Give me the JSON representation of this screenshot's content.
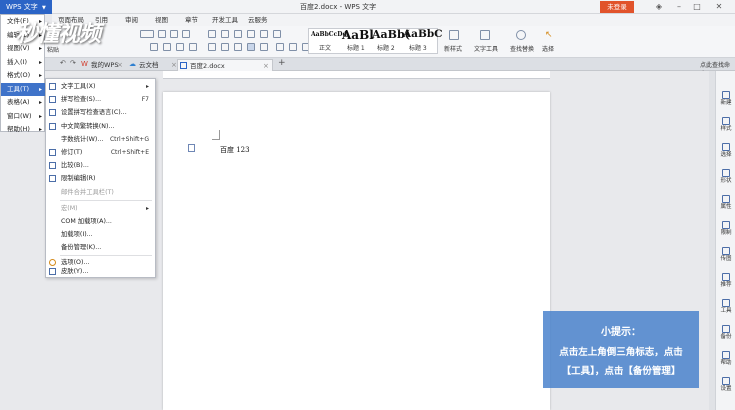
{
  "app": {
    "menu_button": "WPS 文字",
    "window_title": "百度2.docx - WPS 文字",
    "login_label": "未登录"
  },
  "watermark": {
    "text": "秒懂视频"
  },
  "ribbon_tabs": [
    "页面布局",
    "引用",
    "审阅",
    "视图",
    "章节",
    "开发工具",
    "云服务"
  ],
  "ribbon": {
    "styles": [
      {
        "sample": "AaBbCcDd",
        "label": "正文"
      },
      {
        "sample": "AaBl",
        "label": "标题 1"
      },
      {
        "sample": "AaBb(",
        "label": "标题 2"
      },
      {
        "sample": "AaBbC",
        "label": "标题 3"
      }
    ],
    "new_style": "新样式",
    "text_tools": "文字工具",
    "find_replace": "查找替换",
    "select": "选择",
    "paste_hint": "粘贴"
  },
  "doc_tabs": [
    {
      "label": "我的WPS",
      "icon": "wps-icon",
      "active": false
    },
    {
      "label": "云文档",
      "icon": "cloud-icon",
      "active": false
    },
    {
      "label": "百度2.docx",
      "icon": "doc-icon",
      "active": true
    }
  ],
  "find_command": "点此查找命令",
  "main_menu": [
    {
      "label": "文件(F)",
      "active": false
    },
    {
      "label": "编辑(E)",
      "active": false
    },
    {
      "label": "视图(V)",
      "active": false
    },
    {
      "label": "插入(I)",
      "active": false
    },
    {
      "label": "格式(O)",
      "active": false
    },
    {
      "label": "工具(T)",
      "active": true
    },
    {
      "label": "表格(A)",
      "active": false
    },
    {
      "label": "窗口(W)",
      "active": false
    },
    {
      "label": "帮助(H)",
      "active": false
    }
  ],
  "tools_submenu": [
    {
      "label": "文字工具(X)",
      "shortcut": "",
      "arrow": true,
      "icon": "text-tools-icon",
      "disabled": false
    },
    {
      "label": "拼写检查(S)...",
      "shortcut": "F7",
      "arrow": false,
      "icon": "spellcheck-icon",
      "disabled": false
    },
    {
      "label": "设置拼写检查语言(C)...",
      "shortcut": "",
      "arrow": false,
      "icon": "language-icon",
      "disabled": false
    },
    {
      "label": "中文简繁转换(N)...",
      "shortcut": "",
      "arrow": false,
      "icon": "convert-icon",
      "disabled": false
    },
    {
      "label": "字数统计(W)...",
      "shortcut": "Ctrl+Shift+G",
      "arrow": false,
      "icon": "",
      "disabled": false
    },
    {
      "label": "修订(T)",
      "shortcut": "Ctrl+Shift+E",
      "arrow": false,
      "icon": "revision-icon",
      "disabled": false
    },
    {
      "label": "比较(B)...",
      "shortcut": "",
      "arrow": false,
      "icon": "compare-icon",
      "disabled": false
    },
    {
      "label": "限制编辑(R)",
      "shortcut": "",
      "arrow": false,
      "icon": "restrict-icon",
      "disabled": false
    },
    {
      "label": "邮件合并工具栏(T)",
      "shortcut": "",
      "arrow": false,
      "icon": "",
      "disabled": true
    },
    {
      "label": "宏(M)",
      "shortcut": "",
      "arrow": true,
      "icon": "",
      "disabled": true
    },
    {
      "label": "COM 加载项(A)...",
      "shortcut": "",
      "arrow": false,
      "icon": "",
      "disabled": false
    },
    {
      "label": "加载项(I)...",
      "shortcut": "",
      "arrow": false,
      "icon": "",
      "disabled": false
    },
    {
      "label": "备份管理(K)...",
      "shortcut": "",
      "arrow": false,
      "icon": "",
      "disabled": false
    },
    {
      "label": "选项(O)...",
      "shortcut": "",
      "arrow": false,
      "icon": "options-icon",
      "disabled": false
    },
    {
      "label": "皮肤(Y)...",
      "shortcut": "",
      "arrow": false,
      "icon": "skin-icon",
      "disabled": false
    }
  ],
  "document": {
    "text": "百度 123"
  },
  "sidebar": [
    "新建",
    "样式",
    "选择",
    "形状",
    "属性",
    "限制",
    "传图",
    "推荐",
    "工具",
    "备份",
    "帮助",
    "设置"
  ],
  "tip": {
    "title": "小提示：",
    "lines": [
      "点击左上角倒三角标志，点击",
      "【工具】，点击【备份管理】"
    ]
  },
  "colors": {
    "accent": "#2b64c6",
    "login": "#e1532b",
    "tip_bg": "#4a82cd"
  }
}
